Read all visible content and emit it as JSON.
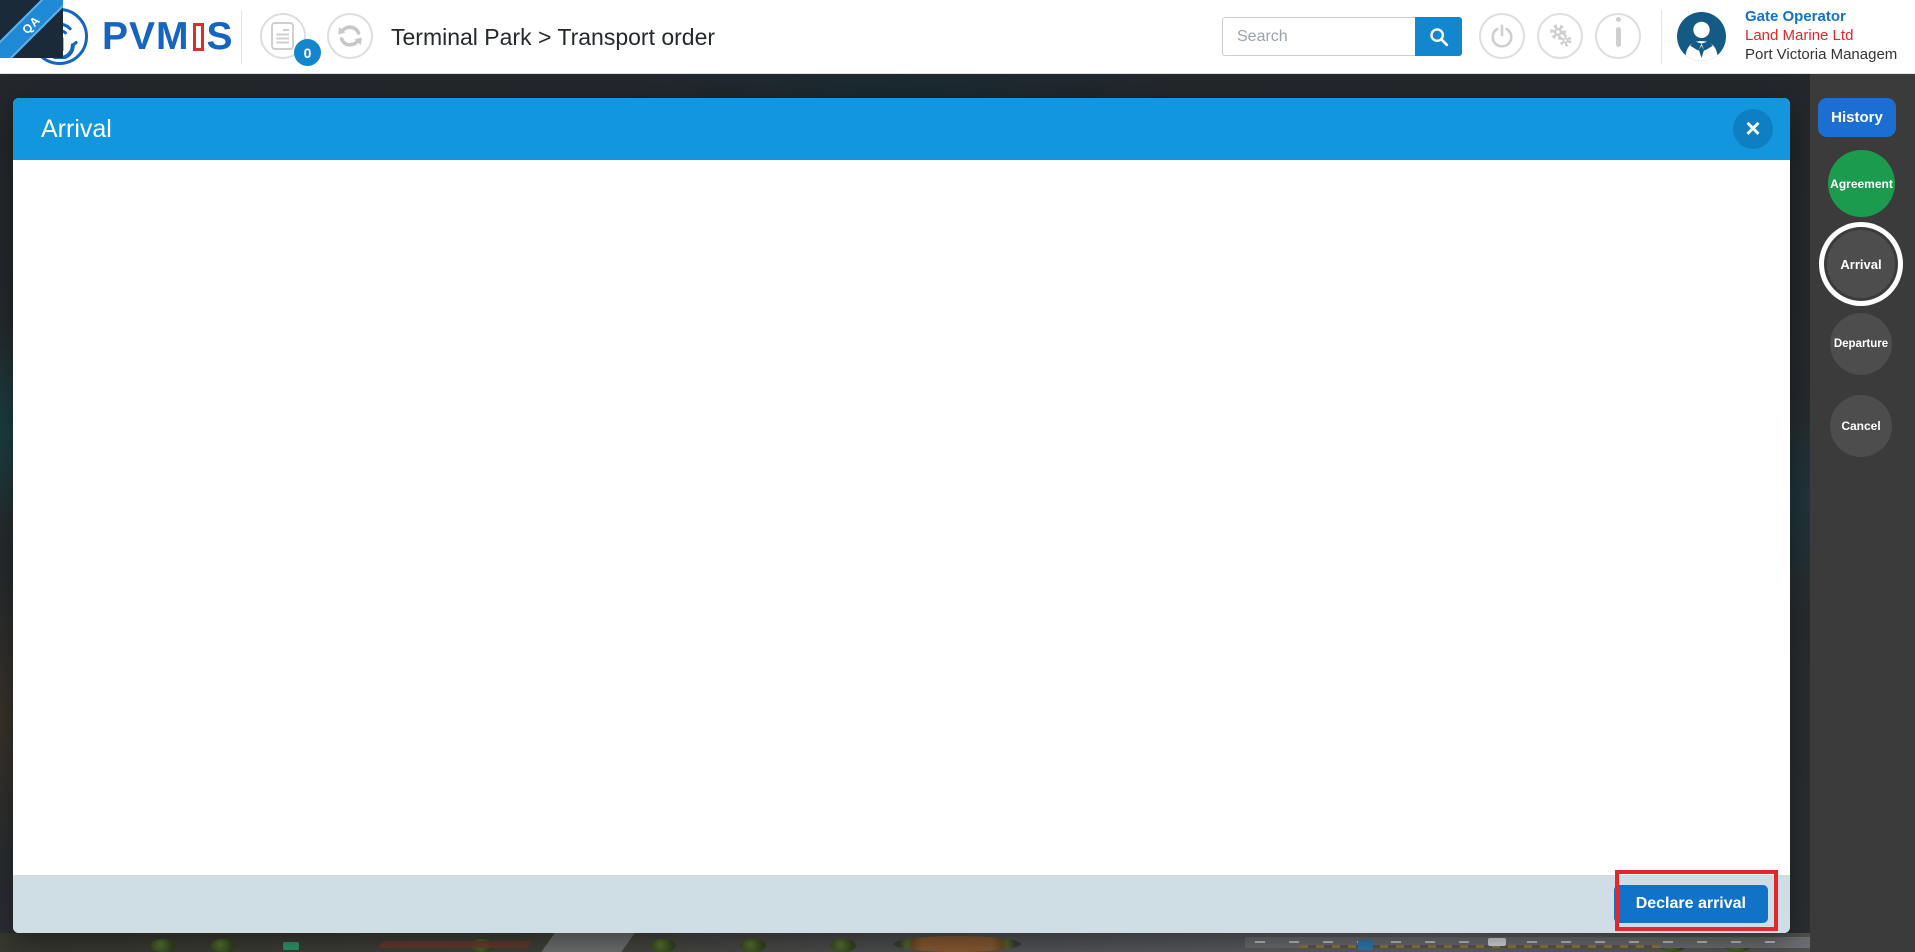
{
  "app": {
    "environment_ribbon": "QA",
    "brand": {
      "name": "PVMIS",
      "prefix": "PVM",
      "accent_letter": "I",
      "suffix": "S"
    },
    "logo_icon": "anchor-signal-icon"
  },
  "header": {
    "documents_button": {
      "icon": "document-icon",
      "badge_count": "0"
    },
    "refresh_button": {
      "icon": "refresh-icon"
    },
    "breadcrumb": "Terminal Park > Transport order",
    "search": {
      "placeholder": "Search",
      "value": "",
      "button_icon": "search-icon"
    },
    "power_button": {
      "icon": "power-icon"
    },
    "settings_button": {
      "icon": "gears-icon"
    },
    "info_button": {
      "icon": "info-icon"
    },
    "user": {
      "avatar_icon": "person-icon",
      "role": "Gate Operator",
      "company": "Land Marine Ltd",
      "organization": "Port Victoria Managem"
    }
  },
  "modal": {
    "title": "Arrival",
    "close_icon": "close-x-icon",
    "close_glyph": "×",
    "body_content": "",
    "footer_button": "Declare arrival",
    "highlight_color": "#e8252a"
  },
  "sidebar": {
    "history_button": "History",
    "steps": [
      {
        "label": "Agreement",
        "state": "completed",
        "color": "#1b9b4d"
      },
      {
        "label": "Arrival",
        "state": "active",
        "color": "#4d4d4d"
      },
      {
        "label": "Departure",
        "state": "default",
        "color": "#4d4d4d"
      },
      {
        "label": "Cancel",
        "state": "default",
        "color": "#4d4d4d"
      }
    ]
  },
  "colors": {
    "modal_header_blue": "#1297de",
    "primary_button_blue": "#1173c8",
    "history_button_blue": "#1b6fd3",
    "search_button_blue": "#1287cd",
    "brand_blue": "#1565c0",
    "brand_red": "#d6302c",
    "badge_blue": "#1287cd",
    "footer_gray_blue": "#cfdde4",
    "sidebar_strip_gray": "#3b3b3b",
    "agreement_green": "#1b9b4d"
  }
}
